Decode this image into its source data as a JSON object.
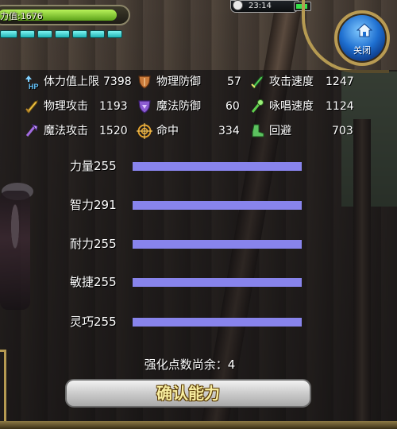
{
  "hud": {
    "hp_text": "力值:1676",
    "hp_fill": 0.93,
    "mp_segments": 7,
    "clock": "23:14",
    "close_label": "关闭"
  },
  "stats": [
    {
      "icon": "hp-up-icon",
      "label": "体力值上限",
      "value": "7398"
    },
    {
      "icon": "shield-icon",
      "label": "物理防御",
      "value": "57"
    },
    {
      "icon": "sword-speed-icon",
      "label": "攻击速度",
      "value": "1247"
    },
    {
      "icon": "sword-icon",
      "label": "物理攻击",
      "value": "1193"
    },
    {
      "icon": "magic-shield-icon",
      "label": "魔法防御",
      "value": "60"
    },
    {
      "icon": "wand-speed-icon",
      "label": "咏唱速度",
      "value": "1124"
    },
    {
      "icon": "magic-attack-icon",
      "label": "魔法攻击",
      "value": "1520"
    },
    {
      "icon": "target-icon",
      "label": "命中",
      "value": "334"
    },
    {
      "icon": "boot-icon",
      "label": "回避",
      "value": "703"
    }
  ],
  "attributes": [
    {
      "label": "力量255",
      "fill": 1.0
    },
    {
      "label": "智力291",
      "fill": 1.0
    },
    {
      "label": "耐力255",
      "fill": 1.0
    },
    {
      "label": "敏捷255",
      "fill": 1.0
    },
    {
      "label": "灵巧255",
      "fill": 1.0
    }
  ],
  "remaining_label": "强化点数尚余：",
  "remaining_value": "4",
  "confirm_label": "确认能力",
  "colors": {
    "bar": "#8884ec",
    "hp": "#8fd43a",
    "mp": "#49d6d6",
    "frame": "#b59a52"
  }
}
